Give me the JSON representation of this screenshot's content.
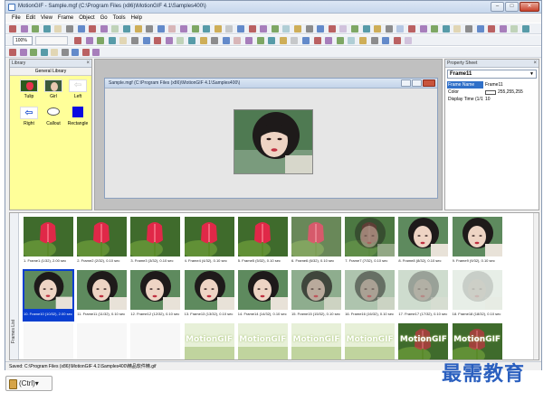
{
  "window": {
    "title": "MotionGIF - Sample.mgf (C:\\Program Files (x86)\\MotionGIF 4.1\\Samples400\\)",
    "controls": {
      "minimize": "–",
      "maximize": "□",
      "close": "✕"
    }
  },
  "menubar": {
    "items": [
      "File",
      "Edit",
      "View",
      "Frame",
      "Object",
      "Go",
      "Tools",
      "Help"
    ]
  },
  "toolbar": {
    "zoom": "100%"
  },
  "library": {
    "panel_title": "Library",
    "title": "General Library",
    "items": [
      {
        "label": "Tulip"
      },
      {
        "label": "Girl"
      },
      {
        "label": "Left"
      },
      {
        "label": "Right"
      },
      {
        "label": "Callout"
      },
      {
        "label": "Rectangle"
      }
    ]
  },
  "document": {
    "title": "Sample.mgf (C:\\Program Files (x86)\\MotionGIF 4.1\\Samples400\\)"
  },
  "property_sheet": {
    "panel_title": "Property Sheet",
    "selected_object": "Frame11",
    "rows": [
      {
        "name": "Frame Name",
        "value": "Frame11"
      },
      {
        "name": "Color",
        "value": "255,255,255",
        "swatch": "#ffffff"
      },
      {
        "name": "Display Time (1/1)",
        "value": "10"
      }
    ]
  },
  "frames": {
    "panel_label": "Frames List",
    "selected_index": 9,
    "items": [
      {
        "label": "1. Frame1 (1/32), 2.00 sec",
        "kind": "tulip"
      },
      {
        "label": "2. Frame2 (2/32), 0.10 sec",
        "kind": "tulip"
      },
      {
        "label": "3. Frame3 (3/32), 0.10 sec",
        "kind": "tulip"
      },
      {
        "label": "4. Frame4 (4/32), 0.10 sec",
        "kind": "tulip"
      },
      {
        "label": "5. Frame5 (5/32), 0.10 sec",
        "kind": "tulip"
      },
      {
        "label": "6. Frame6 (6/32), 0.10 sec",
        "kind": "tulip-fade"
      },
      {
        "label": "7. Frame7 (7/32), 0.10 sec",
        "kind": "blend"
      },
      {
        "label": "8. Frame8 (8/32), 0.10 sec",
        "kind": "girl"
      },
      {
        "label": "9. Frame9 (9/32), 0.10 sec",
        "kind": "girl"
      },
      {
        "label": "10. Frame10 (10/32), 2.00 sec",
        "kind": "girl"
      },
      {
        "label": "11. Frame11 (11/32), 0.10 sec",
        "kind": "girl"
      },
      {
        "label": "12. Frame12 (12/32), 0.10 sec",
        "kind": "girl"
      },
      {
        "label": "13. Frame13 (13/32), 0.10 sec",
        "kind": "girl"
      },
      {
        "label": "14. Frame14 (14/32), 0.10 sec",
        "kind": "girl"
      },
      {
        "label": "15. Frame15 (15/32), 0.10 sec",
        "kind": "girl-fade"
      },
      {
        "label": "16. Frame16 (16/32), 0.10 sec",
        "kind": "girl-fade2"
      },
      {
        "label": "17. Frame17 (17/32), 0.10 sec",
        "kind": "girl-fade3"
      },
      {
        "label": "18. Frame18 (18/32), 0.10 sec",
        "kind": "girl-fade4"
      },
      {
        "label": "19. Frame19 (19/32), 0.10 sec",
        "kind": "blank"
      },
      {
        "label": "20. Frame20 (20/32), 0.10 sec",
        "kind": "blank"
      },
      {
        "label": "21. Frame21 (21/32), 0.10 sec",
        "kind": "blank"
      },
      {
        "label": "22. Frame22 (22/32), 0.10 sec",
        "kind": "text",
        "text": "MotionGIF"
      },
      {
        "label": "23. Frame23 (23/32), 0.10 sec",
        "kind": "text",
        "text": "MotionGIF"
      },
      {
        "label": "24. Frame24 (24/32), 0.10 sec",
        "kind": "text",
        "text": "MotionGIF"
      },
      {
        "label": "25. Frame25 (25/32), 0.10 sec",
        "kind": "text",
        "text": "MotionGIF"
      },
      {
        "label": "26. Frame26 (26/32), 0.10 sec",
        "kind": "text-tulip",
        "text": "MotionGIF"
      },
      {
        "label": "27. Frame27 (27/32), 0.10 sec",
        "kind": "text-tulip",
        "text": "MotionGIF"
      }
    ]
  },
  "status": {
    "text": "Saved: C:\\Program Files (x86)\\MotionGIF 4.1\\Samples400\\精品软件精.gif"
  },
  "overlay": {
    "ctrl_label": "(Ctrl)▾",
    "watermark": "最需教育"
  },
  "colors": {
    "library_bg": "#ffff99",
    "selection_blue": "#0a3fd0",
    "workarea_gray": "#c0c0c0",
    "watermark_blue": "#2a5fbf"
  }
}
